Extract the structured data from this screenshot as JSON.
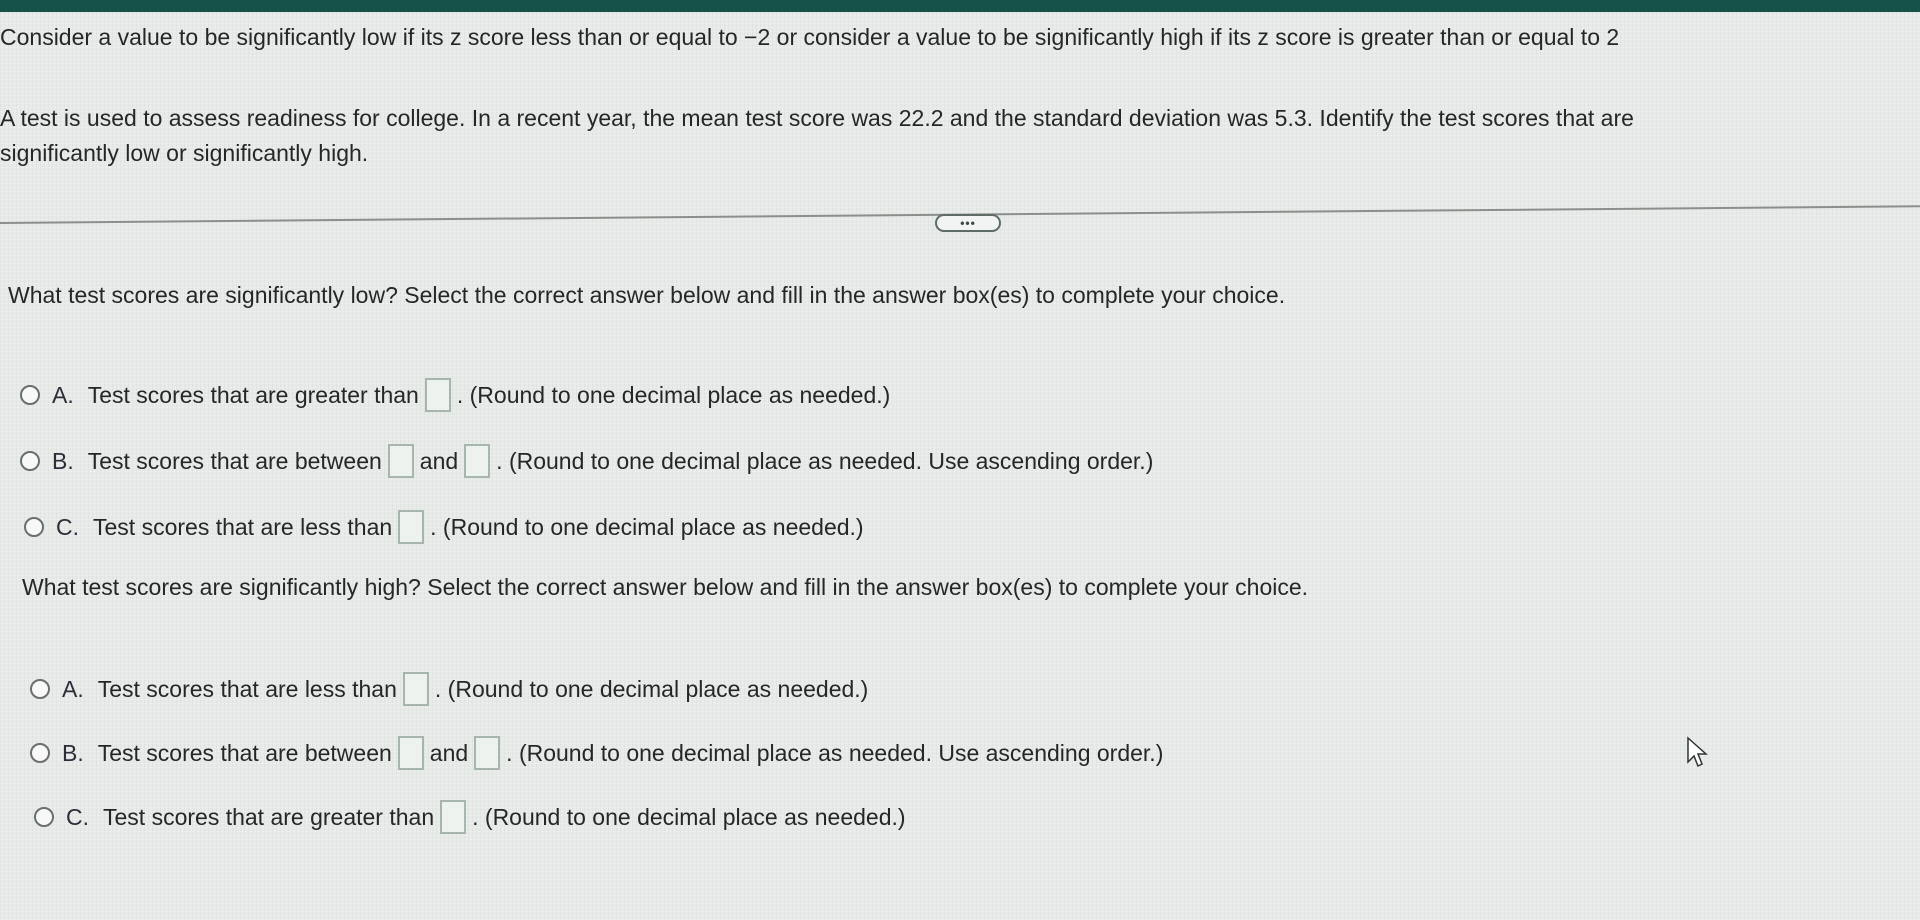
{
  "intro": "Consider a value to be significantly low if its z score less than or equal to −2 or consider a value to be significantly high if its z score is greater than or equal to 2",
  "problem_line1": "A test is used to assess readiness for college. In a recent year, the mean test score was 22.2 and the standard deviation was 5.3. Identify the test scores that are",
  "problem_line2": "significantly low or significantly high.",
  "more_button": "•••",
  "low_question": {
    "prompt": "What test scores are significantly low? Select the correct answer below and fill in the answer box(es) to complete your choice.",
    "options": [
      {
        "letter": "A.",
        "before": "Test scores that are greater than",
        "after": ". (Round to one decimal place as needed.)"
      },
      {
        "letter": "B.",
        "before": "Test scores that are between",
        "middle": "and",
        "after": ". (Round to one decimal place as needed. Use ascending order.)"
      },
      {
        "letter": "C.",
        "before": "Test scores that are less than",
        "after": ". (Round to one decimal place as needed.)"
      }
    ]
  },
  "high_question": {
    "prompt": "What test scores are significantly high? Select the correct answer below and fill in the answer box(es) to complete your choice.",
    "options": [
      {
        "letter": "A.",
        "before": "Test scores that are less than",
        "after": ". (Round to one decimal place as needed.)"
      },
      {
        "letter": "B.",
        "before": "Test scores that are between",
        "middle": "and",
        "after": ". (Round to one decimal place as needed. Use ascending order.)"
      },
      {
        "letter": "C.",
        "before": "Test scores that are greater than",
        "after": ". (Round to one decimal place as needed.)"
      }
    ]
  },
  "colors": {
    "header_bar": "#17524a"
  }
}
